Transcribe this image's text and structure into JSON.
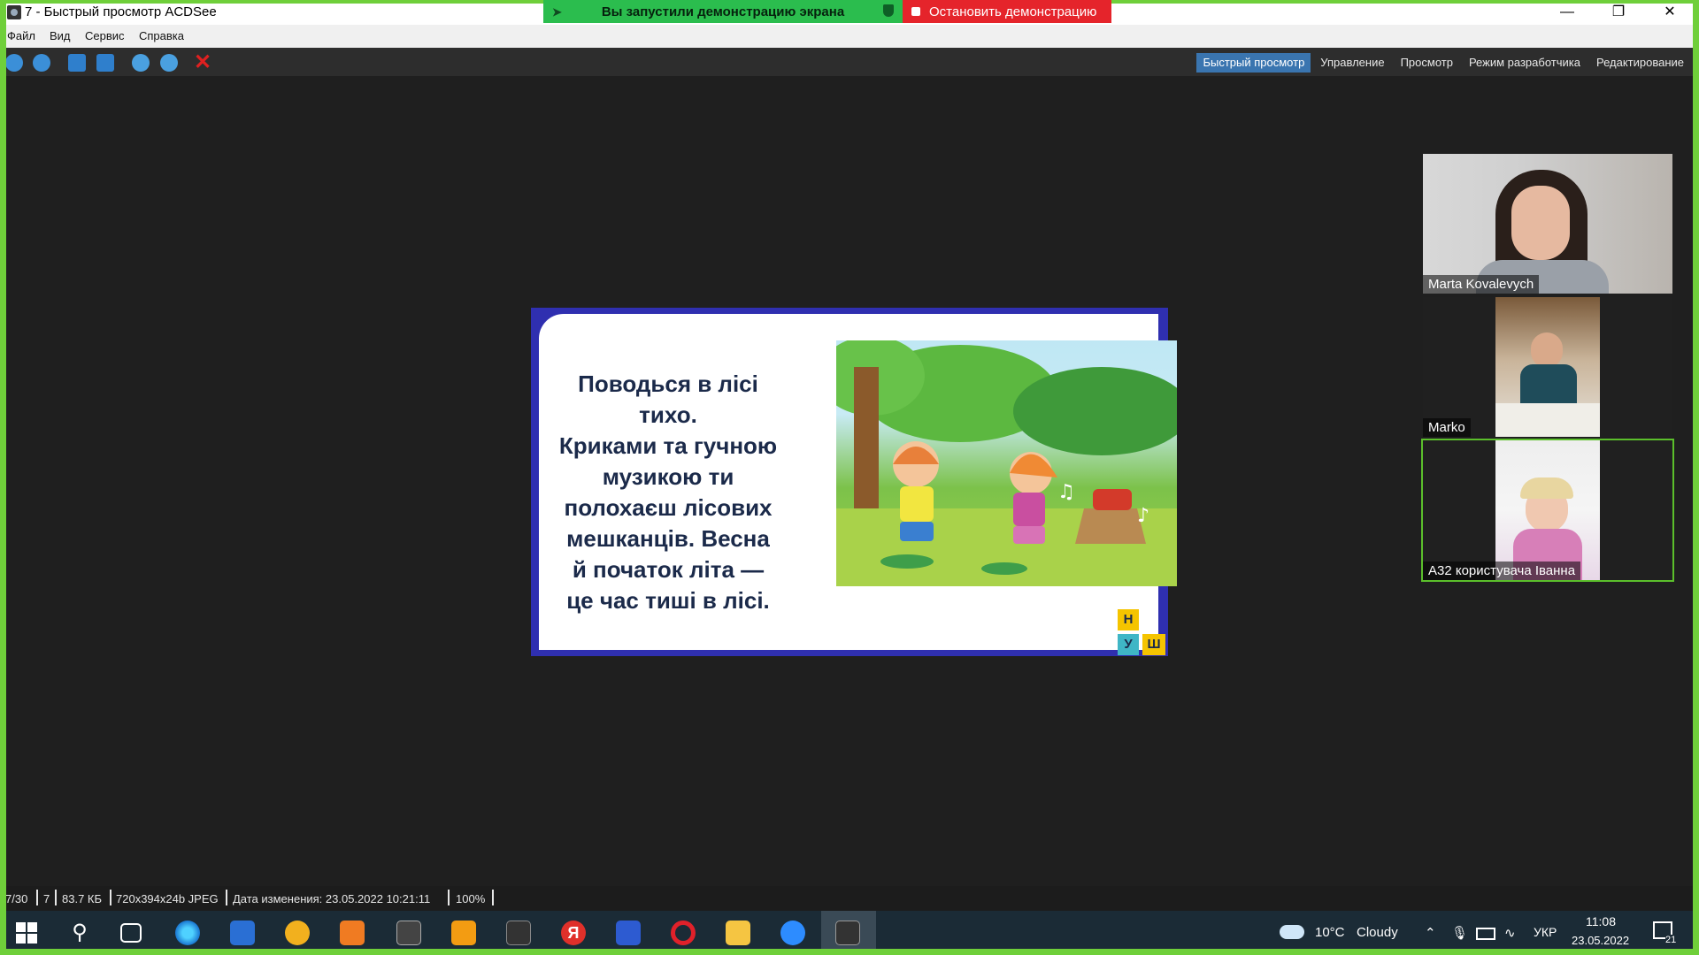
{
  "window": {
    "title": "7 - Быстрый просмотр ACDSee"
  },
  "share": {
    "status": "Вы запустили демонстрацию экрана",
    "stop": "Остановить демонстрацию"
  },
  "menu": [
    "Файл",
    "Вид",
    "Сервис",
    "Справка"
  ],
  "tabs": [
    "Быстрый просмотр",
    "Управление",
    "Просмотр",
    "Режим разработчика",
    "Редактирование"
  ],
  "slide": {
    "lines": [
      "Поводься в лісі тихо.",
      "Криками та гучною",
      "музикою ти",
      "полохаєш лісових",
      "мешканців. Весна",
      "й початок літа —",
      "це час тиші в лісі."
    ],
    "logo": [
      "Н",
      "У",
      "Ш"
    ]
  },
  "participants": [
    {
      "name": "Marta Kovalevych"
    },
    {
      "name": "Marko"
    },
    {
      "name": "A32 користувача Іванна"
    }
  ],
  "status": {
    "position": "7/30",
    "name": "7",
    "size": "83.7 КБ",
    "dimensions": "720x394x24b JPEG",
    "modified": "Дата изменения: 23.05.2022 10:21:11",
    "zoom": "100%"
  },
  "taskbar": {
    "weather_temp": "10°C",
    "weather_text": "Cloudy",
    "language": "УКР",
    "time": "11:08",
    "date": "23.05.2022",
    "notifications": "21"
  }
}
